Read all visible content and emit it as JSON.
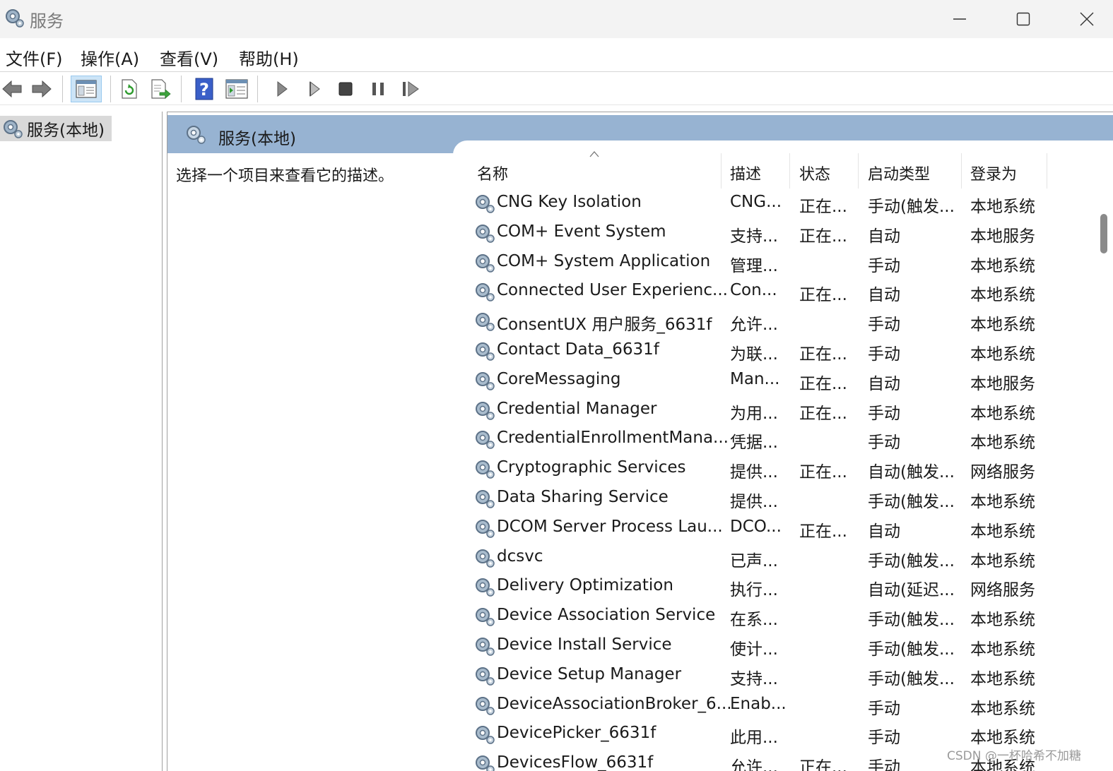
{
  "window": {
    "title": "服务",
    "icon": "gears-icon"
  },
  "menu": [
    "文件(F)",
    "操作(A)",
    "查看(V)",
    "帮助(H)"
  ],
  "toolbar": {
    "buttons": [
      "back-arrow-icon",
      "forward-arrow-icon",
      "show-hide-console-tree-icon",
      "refresh-icon",
      "export-list-icon",
      "help-icon",
      "properties-pane-icon",
      "start-service-icon",
      "start-service-alt-icon",
      "stop-service-icon",
      "pause-service-icon",
      "restart-service-icon"
    ]
  },
  "tree": {
    "root_label": "服务(本地)"
  },
  "pane": {
    "header": "服务(本地)",
    "description": "选择一个项目来查看它的描述。"
  },
  "columns": {
    "name": "名称",
    "description": "描述",
    "status": "状态",
    "startup": "启动类型",
    "logon": "登录为"
  },
  "services": [
    {
      "name": "CNG Key Isolation",
      "desc": "CNG...",
      "status": "正在...",
      "startup": "手动(触发...",
      "logon": "本地系统"
    },
    {
      "name": "COM+ Event System",
      "desc": "支持...",
      "status": "正在...",
      "startup": "自动",
      "logon": "本地服务"
    },
    {
      "name": "COM+ System Application",
      "desc": "管理...",
      "status": "",
      "startup": "手动",
      "logon": "本地系统"
    },
    {
      "name": "Connected User Experienc...",
      "desc": "Con...",
      "status": "正在...",
      "startup": "自动",
      "logon": "本地系统"
    },
    {
      "name": "ConsentUX 用户服务_6631f",
      "desc": "允许...",
      "status": "",
      "startup": "手动",
      "logon": "本地系统"
    },
    {
      "name": "Contact Data_6631f",
      "desc": "为联...",
      "status": "正在...",
      "startup": "手动",
      "logon": "本地系统"
    },
    {
      "name": "CoreMessaging",
      "desc": "Man...",
      "status": "正在...",
      "startup": "自动",
      "logon": "本地服务"
    },
    {
      "name": "Credential Manager",
      "desc": "为用...",
      "status": "正在...",
      "startup": "手动",
      "logon": "本地系统"
    },
    {
      "name": "CredentialEnrollmentMana...",
      "desc": "凭据...",
      "status": "",
      "startup": "手动",
      "logon": "本地系统"
    },
    {
      "name": "Cryptographic Services",
      "desc": "提供...",
      "status": "正在...",
      "startup": "自动(触发...",
      "logon": "网络服务"
    },
    {
      "name": "Data Sharing Service",
      "desc": "提供...",
      "status": "",
      "startup": "手动(触发...",
      "logon": "本地系统"
    },
    {
      "name": "DCOM Server Process Lau...",
      "desc": "DCO...",
      "status": "正在...",
      "startup": "自动",
      "logon": "本地系统"
    },
    {
      "name": "dcsvc",
      "desc": "已声...",
      "status": "",
      "startup": "手动(触发...",
      "logon": "本地系统"
    },
    {
      "name": "Delivery Optimization",
      "desc": "执行...",
      "status": "",
      "startup": "自动(延迟...",
      "logon": "网络服务"
    },
    {
      "name": "Device Association Service",
      "desc": "在系...",
      "status": "",
      "startup": "手动(触发...",
      "logon": "本地系统"
    },
    {
      "name": "Device Install Service",
      "desc": "使计...",
      "status": "",
      "startup": "手动(触发...",
      "logon": "本地系统"
    },
    {
      "name": "Device Setup Manager",
      "desc": "支持...",
      "status": "",
      "startup": "手动(触发...",
      "logon": "本地系统"
    },
    {
      "name": "DeviceAssociationBroker_6...",
      "desc": "Enab...",
      "status": "",
      "startup": "手动",
      "logon": "本地系统"
    },
    {
      "name": "DevicePicker_6631f",
      "desc": "此用...",
      "status": "",
      "startup": "手动",
      "logon": "本地系统"
    },
    {
      "name": "DevicesFlow_6631f",
      "desc": "允许...",
      "status": "正在...",
      "startup": "手动",
      "logon": "本地系统"
    }
  ],
  "watermark": "CSDN @一杯哈希不加糖"
}
